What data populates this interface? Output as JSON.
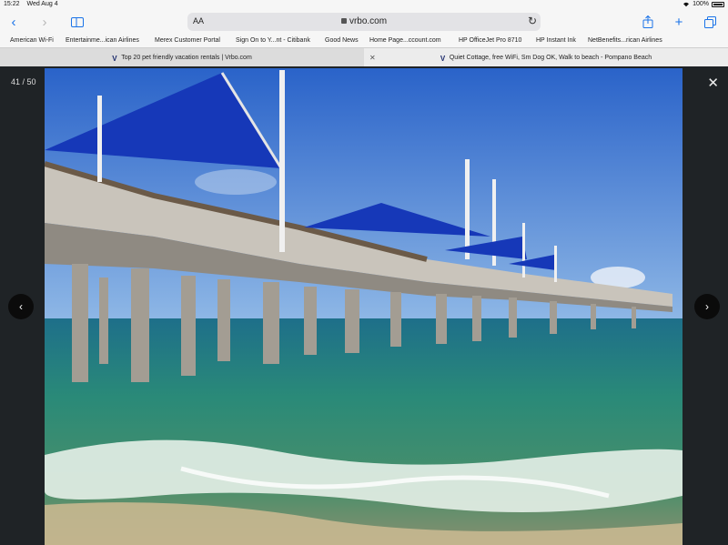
{
  "status": {
    "time": "15:22",
    "date": "Wed Aug 4",
    "battery": "100%"
  },
  "toolbar": {
    "text_size": "AA",
    "url": "vrbo.com",
    "icons": [
      "back-icon",
      "forward-icon",
      "sidebar-icon",
      "reload-icon",
      "share-icon",
      "new-tab-icon",
      "tabs-overview-icon"
    ]
  },
  "bookmarks": [
    "American Wi-Fi",
    "Entertainme...ican Airlines",
    "Merex Customer Portal",
    "Sign On to Y...nt - Citibank",
    "Good News",
    "Home Page...ccount.com",
    "HP OfficeJet Pro 8710",
    "HP Instant Ink",
    "NetBenefits...rican Airlines"
  ],
  "tabs": [
    {
      "title": "Top 20 pet friendly vacation rentals | Vrbo.com"
    },
    {
      "title": "Quiet Cottage, free WiFi, Sm Dog OK, Walk to beach - Pompano Beach"
    }
  ],
  "viewer": {
    "counter": "41 / 50"
  },
  "colors": {
    "accent": "#1a73e8",
    "sky": "#2f6fd0",
    "canopy": "#1638b8",
    "sea": "#1f8a7c"
  }
}
